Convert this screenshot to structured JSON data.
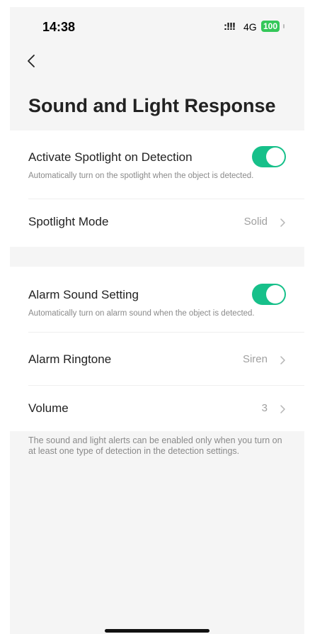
{
  "status_bar": {
    "time": "14:38",
    "signal": ":!!!",
    "network": "4G",
    "battery": "100"
  },
  "page": {
    "back_icon": "chevron-left-icon",
    "title": "Sound and Light Response"
  },
  "spotlight_section": {
    "activate": {
      "label": "Activate Spotlight on Detection",
      "description": "Automatically turn on the spotlight when the object is detected.",
      "enabled": true
    },
    "mode": {
      "label": "Spotlight Mode",
      "value": "Solid"
    }
  },
  "alarm_section": {
    "sound": {
      "label": "Alarm Sound Setting",
      "description": "Automatically turn on alarm sound when the object is detected.",
      "enabled": true
    },
    "ringtone": {
      "label": "Alarm Ringtone",
      "value": "Siren"
    },
    "volume": {
      "label": "Volume",
      "value": "3"
    }
  },
  "footer_note": "The sound and light alerts can be enabled only when you turn on at least one type of detection in the detection settings.",
  "colors": {
    "toggle_on": "#17c08a",
    "battery": "#34c759"
  }
}
